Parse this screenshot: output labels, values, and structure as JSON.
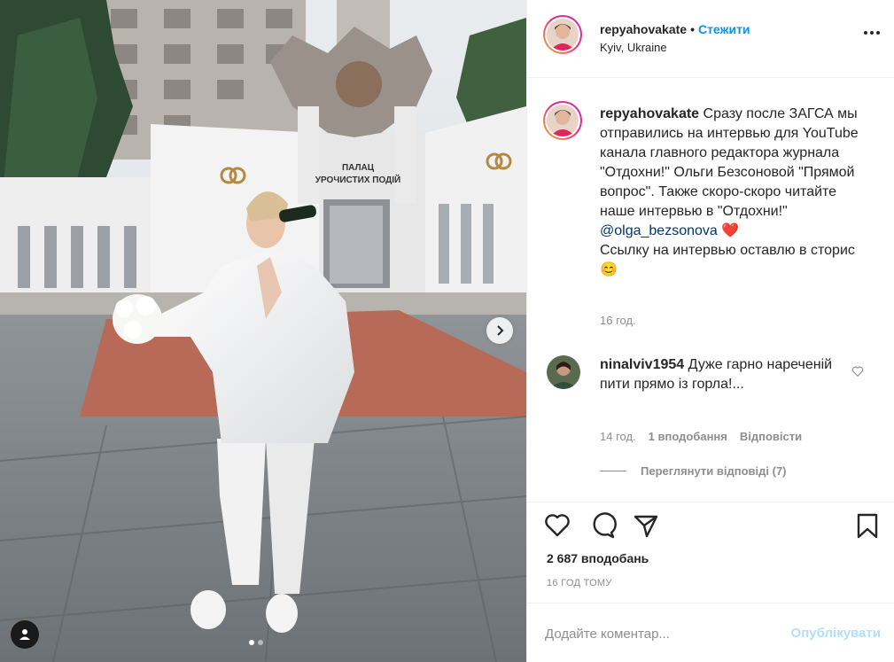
{
  "post": {
    "author": "repyahovakate",
    "location": "Kyiv, Ukraine",
    "follow_label": "Стежити",
    "separator": "•",
    "more_icon": "more-horizontal-icon"
  },
  "photo": {
    "building_sign_line1": "ПАЛАЦ",
    "building_sign_line2": "УРОЧИСТИХ ПОДІЙ",
    "carousel_next_icon": "chevron-right-icon",
    "tag_icon": "user-tag-icon",
    "slide_count": 2,
    "active_slide": 1
  },
  "caption": {
    "username": "repyahovakate",
    "text_part1": "Сразу после ЗАГСА мы отправились на интервью для YouTube канала главного редактора журнала \"Отдохни!\" Ольги Безсоновой \"Прямой вопрос\". Также скоро-скоро читайте наше интервью в \"Отдохни!\"",
    "mention": "@olga_bezsonova",
    "heart_emoji": "❤️",
    "text_part2": "Ссылку на интервью оставлю в сторис",
    "smile_emoji": "😊",
    "time": "16 год."
  },
  "comment": {
    "username": "ninalviv1954",
    "text": "Дуже гарно нареченій пити прямо із горла!...",
    "time": "14 год.",
    "likes": "1 вподобання",
    "reply_label": "Відповісти",
    "view_replies": "Переглянути відповіді (7)"
  },
  "actions": {
    "like_icon": "heart-icon",
    "comment_icon": "comment-icon",
    "share_icon": "share-paper-plane-icon",
    "save_icon": "bookmark-icon",
    "likes_count": "2 687 вподобань",
    "posted_ago": "16 ГОД ТОМУ"
  },
  "add_comment": {
    "placeholder": "Додайте коментар...",
    "publish_label": "Опублікувати"
  },
  "colors": {
    "accent_blue": "#0095f6",
    "publish_disabled": "#b2dffc",
    "text": "#262626",
    "muted": "#8e8e8e",
    "emoji_heart": "#e0245e"
  }
}
